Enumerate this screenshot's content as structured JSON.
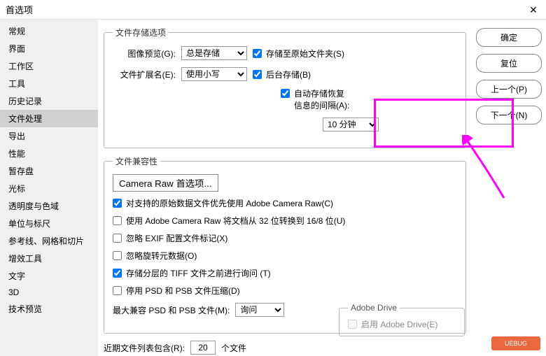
{
  "title": "首选项",
  "sidebar": {
    "items": [
      {
        "label": "常规"
      },
      {
        "label": "界面"
      },
      {
        "label": "工作区"
      },
      {
        "label": "工具"
      },
      {
        "label": "历史记录"
      },
      {
        "label": "文件处理"
      },
      {
        "label": "导出"
      },
      {
        "label": "性能"
      },
      {
        "label": "暂存盘"
      },
      {
        "label": "光标"
      },
      {
        "label": "透明度与色域"
      },
      {
        "label": "单位与标尺"
      },
      {
        "label": "参考线、网格和切片"
      },
      {
        "label": "增效工具"
      },
      {
        "label": "文字"
      },
      {
        "label": "3D"
      },
      {
        "label": "技术预览"
      }
    ],
    "activeIndex": 5
  },
  "buttons": {
    "ok": "确定",
    "cancel": "复位",
    "prev": "上一个(P)",
    "next": "下一个(N)"
  },
  "fileStorage": {
    "legend": "文件存储选项",
    "imagePreview_label": "图像预览(G):",
    "imagePreview_value": "总是存储",
    "fileExt_label": "文件扩展名(E):",
    "fileExt_value": "使用小写",
    "saveToOriginal": "存储至原始文件夹(S)",
    "backgroundSave": "后台存储(B)",
    "autoRecover_line1": "自动存储恢复",
    "autoRecover_line2": "信息的间隔(A):",
    "interval_value": "10 分钟"
  },
  "compat": {
    "legend": "文件兼容性",
    "cameraRawBtn": "Camera Raw 首选项...",
    "preferRaw": "对支持的原始数据文件优先使用 Adobe Camera Raw(C)",
    "convert32to16": "使用 Adobe Camera Raw 将文档从 32 位转换到 16/8 位(U)",
    "ignoreExif": "忽略 EXIF 配置文件标记(X)",
    "ignoreRotation": "忽略旋转元数据(O)",
    "askLayeredTiff": "存储分层的 TIFF 文件之前进行询问 (T)",
    "disablePsdPsb": "停用 PSD 和 PSB 文件压缩(D)",
    "maxCompat_label": "最大兼容 PSD 和 PSB 文件(M):",
    "maxCompat_value": "询问"
  },
  "adobeDrive": {
    "legend": "Adobe Drive",
    "enable": "启用 Adobe Drive(E)"
  },
  "recentFiles": {
    "label_before": "近期文件列表包含(R):",
    "value": "20",
    "label_after": "个文件"
  },
  "watermark": "UEBUG"
}
